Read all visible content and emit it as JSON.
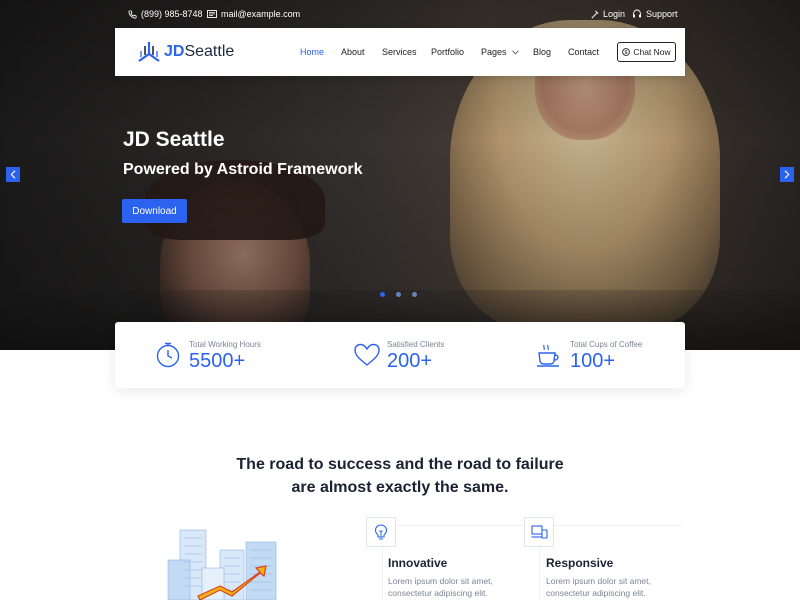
{
  "topbar": {
    "phone": "(899) 985-8748",
    "email": "mail@example.com",
    "login": "Login",
    "support": "Support"
  },
  "navbar": {
    "logo_prefix": "JD",
    "logo_suffix": "Seattle",
    "items": [
      {
        "label": "Home"
      },
      {
        "label": "About"
      },
      {
        "label": "Services"
      },
      {
        "label": "Portfolio"
      },
      {
        "label": "Pages"
      },
      {
        "label": "Blog"
      },
      {
        "label": "Contact"
      }
    ],
    "chat_button": "Chat Now"
  },
  "hero": {
    "title": "JD Seattle",
    "subtitle": "Powered by Astroid Framework",
    "cta": "Download"
  },
  "stats": [
    {
      "label": "Total Working Hours",
      "value": "5500+",
      "icon": "clock-icon"
    },
    {
      "label": "Satisfied Clients",
      "value": "200+",
      "icon": "heart-icon"
    },
    {
      "label": "Total Cups of Coffee",
      "value": "100+",
      "icon": "coffee-cup-icon"
    }
  ],
  "section": {
    "title_line1": "The road to success and the road to failure",
    "title_line2": "are almost exactly the same."
  },
  "features": [
    {
      "title": "Innovative",
      "desc": "Lorem ipsum dolor sit amet, consectetur adipiscing elit.",
      "icon": "lightbulb-icon"
    },
    {
      "title": "Responsive",
      "desc": "Lorem ipsum dolor sit amet, consectetur adipiscing elit.",
      "icon": "devices-icon"
    }
  ],
  "colors": {
    "accent": "#2b62f0",
    "heading": "#1a2233",
    "muted": "#7b8595"
  }
}
